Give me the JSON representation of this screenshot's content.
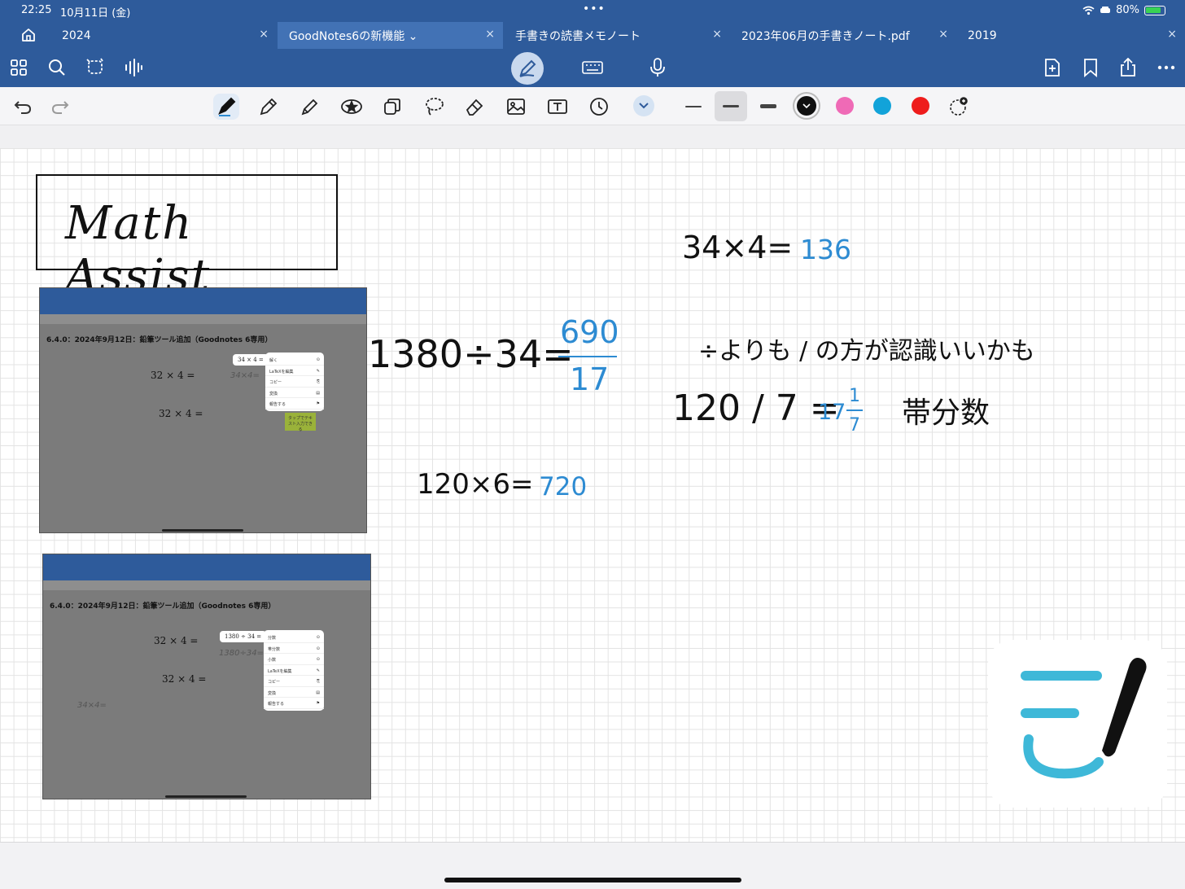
{
  "status_bar": {
    "time": "22:25",
    "date": "10月11日 (金)",
    "multitask_dots": "•••",
    "battery": "80%"
  },
  "tabs": [
    {
      "label": "2024"
    },
    {
      "label": "GoodNotes6の新機能 ⌄",
      "active": true
    },
    {
      "label": "手書きの読書メモノート"
    },
    {
      "label": "2023年06月の手書きノート.pdf"
    },
    {
      "label": "2019"
    }
  ],
  "tab_close_symbol": "×",
  "colors": {
    "header_blue": "#2e5b9b",
    "active_tab": "#4272b5",
    "ink_blue": "#2d8bd2",
    "palette": [
      "#111111",
      "#ef6ab6",
      "#12a3d9",
      "#ee1c1c"
    ]
  },
  "page": {
    "title": "Math Assist",
    "embedded_shot_1": {
      "heading": "6.4.0：2024年9月12日：鉛筆ツール追加（Goodnotes 6専用）",
      "eq1": "32 × 4 =",
      "eq2": "32 × 4 =",
      "bubble": "34 × 4 =",
      "hand": "34×4=",
      "menu": [
        "解く",
        "LaTeXを編集",
        "コピー",
        "変換",
        "報告する"
      ],
      "sticky": "タップでテキスト入力できる"
    },
    "embedded_shot_2": {
      "heading": "6.4.0：2024年9月12日：鉛筆ツール追加（Goodnotes 6専用）",
      "eq1": "32 × 4 =",
      "eq2": "32 × 4 =",
      "bubble": "1380 ÷ 34 =",
      "hand": "1380÷34=",
      "hand2": "34×4=",
      "menu": [
        "分数",
        "帯分数",
        "小数",
        "LaTeXを編集",
        "コピー",
        "変換",
        "報告する"
      ]
    },
    "handwriting": {
      "eq_mult1_left": "34×4=",
      "eq_mult1_answer": "136",
      "eq_div1_left": "1380÷34=",
      "eq_div1_num": "690",
      "eq_div1_den": "17",
      "note": "÷よりも / の方が認識いいかも",
      "eq_div2_left": "120 / 7 =",
      "eq_div2_whole": "17",
      "eq_div2_num": "1",
      "eq_div2_den": "7",
      "mixed_label": "帯分数",
      "eq_mult2_left": "120×6=",
      "eq_mult2_answer": "720"
    }
  }
}
